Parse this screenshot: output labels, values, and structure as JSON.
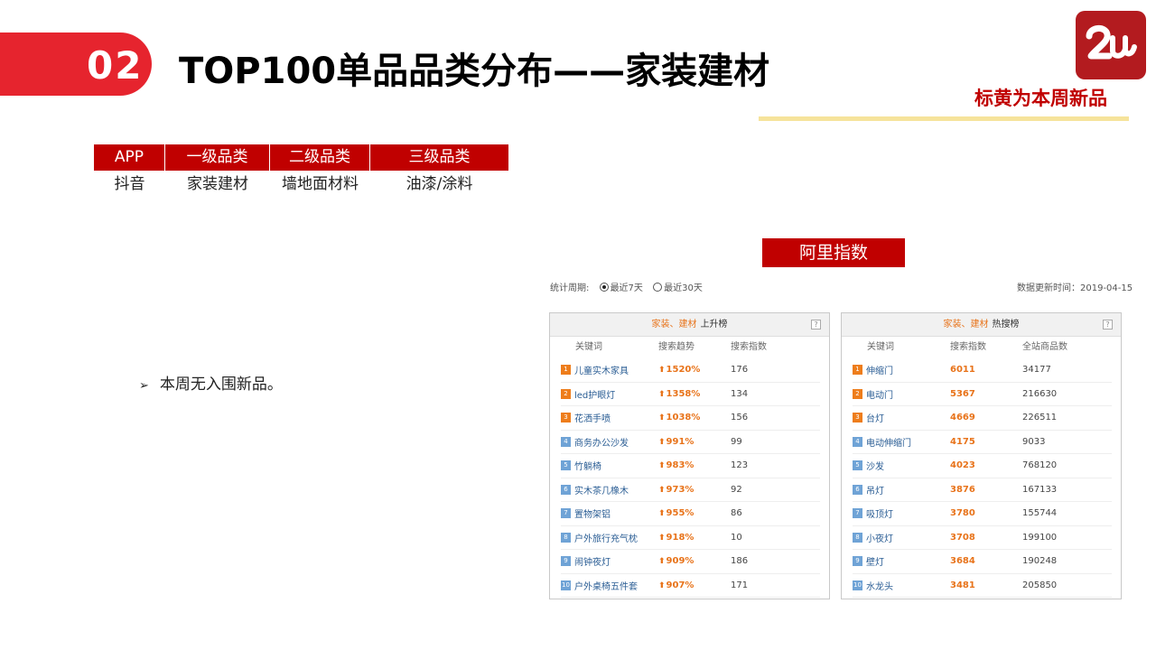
{
  "header": {
    "number": "02",
    "title": "TOP100单品品类分布——家装建材",
    "note": "标黄为本周新品",
    "accent_color": "#e6242e",
    "logo_icon": "brand-logo-icon"
  },
  "category_table": {
    "headers": [
      "APP",
      "一级品类",
      "二级品类",
      "三级品类"
    ],
    "values": [
      "抖音",
      "家装建材",
      "墙地面材料",
      "油漆/涂料"
    ],
    "header_color": "#c00000"
  },
  "bullet_text": "本周无入围新品。",
  "ali": {
    "title": "阿里指数",
    "period_label": "统计周期:",
    "options": [
      "最近7天",
      "最近30天"
    ],
    "selected": "最近7天",
    "update": "数据更新时间：2019-04-15",
    "left_panel": {
      "category": "家装、建材",
      "kind": "上升榜",
      "columns": [
        "关键词",
        "搜索趋势",
        "搜索指数"
      ],
      "rows": [
        {
          "rank": "1",
          "keyword": "儿童实木家具",
          "value": "1520%",
          "index": "176"
        },
        {
          "rank": "2",
          "keyword": "led护眼灯",
          "value": "1358%",
          "index": "134"
        },
        {
          "rank": "3",
          "keyword": "花洒手喷",
          "value": "1038%",
          "index": "156"
        },
        {
          "rank": "4",
          "keyword": "商务办公沙发",
          "value": "991%",
          "index": "99"
        },
        {
          "rank": "5",
          "keyword": "竹躺椅",
          "value": "983%",
          "index": "123"
        },
        {
          "rank": "6",
          "keyword": "实木茶几橡木",
          "value": "973%",
          "index": "92"
        },
        {
          "rank": "7",
          "keyword": "置物架铝",
          "value": "955%",
          "index": "86"
        },
        {
          "rank": "8",
          "keyword": "户外旅行充气枕",
          "value": "918%",
          "index": "10"
        },
        {
          "rank": "9",
          "keyword": "闹钟夜灯",
          "value": "909%",
          "index": "186"
        },
        {
          "rank": "10",
          "keyword": "户外桌椅五件套",
          "value": "907%",
          "index": "171"
        }
      ]
    },
    "right_panel": {
      "category": "家装、建材",
      "kind": "热搜榜",
      "columns": [
        "关键词",
        "搜索指数",
        "全站商品数"
      ],
      "rows": [
        {
          "rank": "1",
          "keyword": "伸缩门",
          "value": "6011",
          "index": "34177"
        },
        {
          "rank": "2",
          "keyword": "电动门",
          "value": "5367",
          "index": "216630"
        },
        {
          "rank": "3",
          "keyword": "台灯",
          "value": "4669",
          "index": "226511"
        },
        {
          "rank": "4",
          "keyword": "电动伸缩门",
          "value": "4175",
          "index": "9033"
        },
        {
          "rank": "5",
          "keyword": "沙发",
          "value": "4023",
          "index": "768120"
        },
        {
          "rank": "6",
          "keyword": "吊灯",
          "value": "3876",
          "index": "167133"
        },
        {
          "rank": "7",
          "keyword": "吸顶灯",
          "value": "3780",
          "index": "155744"
        },
        {
          "rank": "8",
          "keyword": "小夜灯",
          "value": "3708",
          "index": "199100"
        },
        {
          "rank": "9",
          "keyword": "壁灯",
          "value": "3684",
          "index": "190248"
        },
        {
          "rank": "10",
          "keyword": "水龙头",
          "value": "3481",
          "index": "205850"
        }
      ]
    }
  }
}
